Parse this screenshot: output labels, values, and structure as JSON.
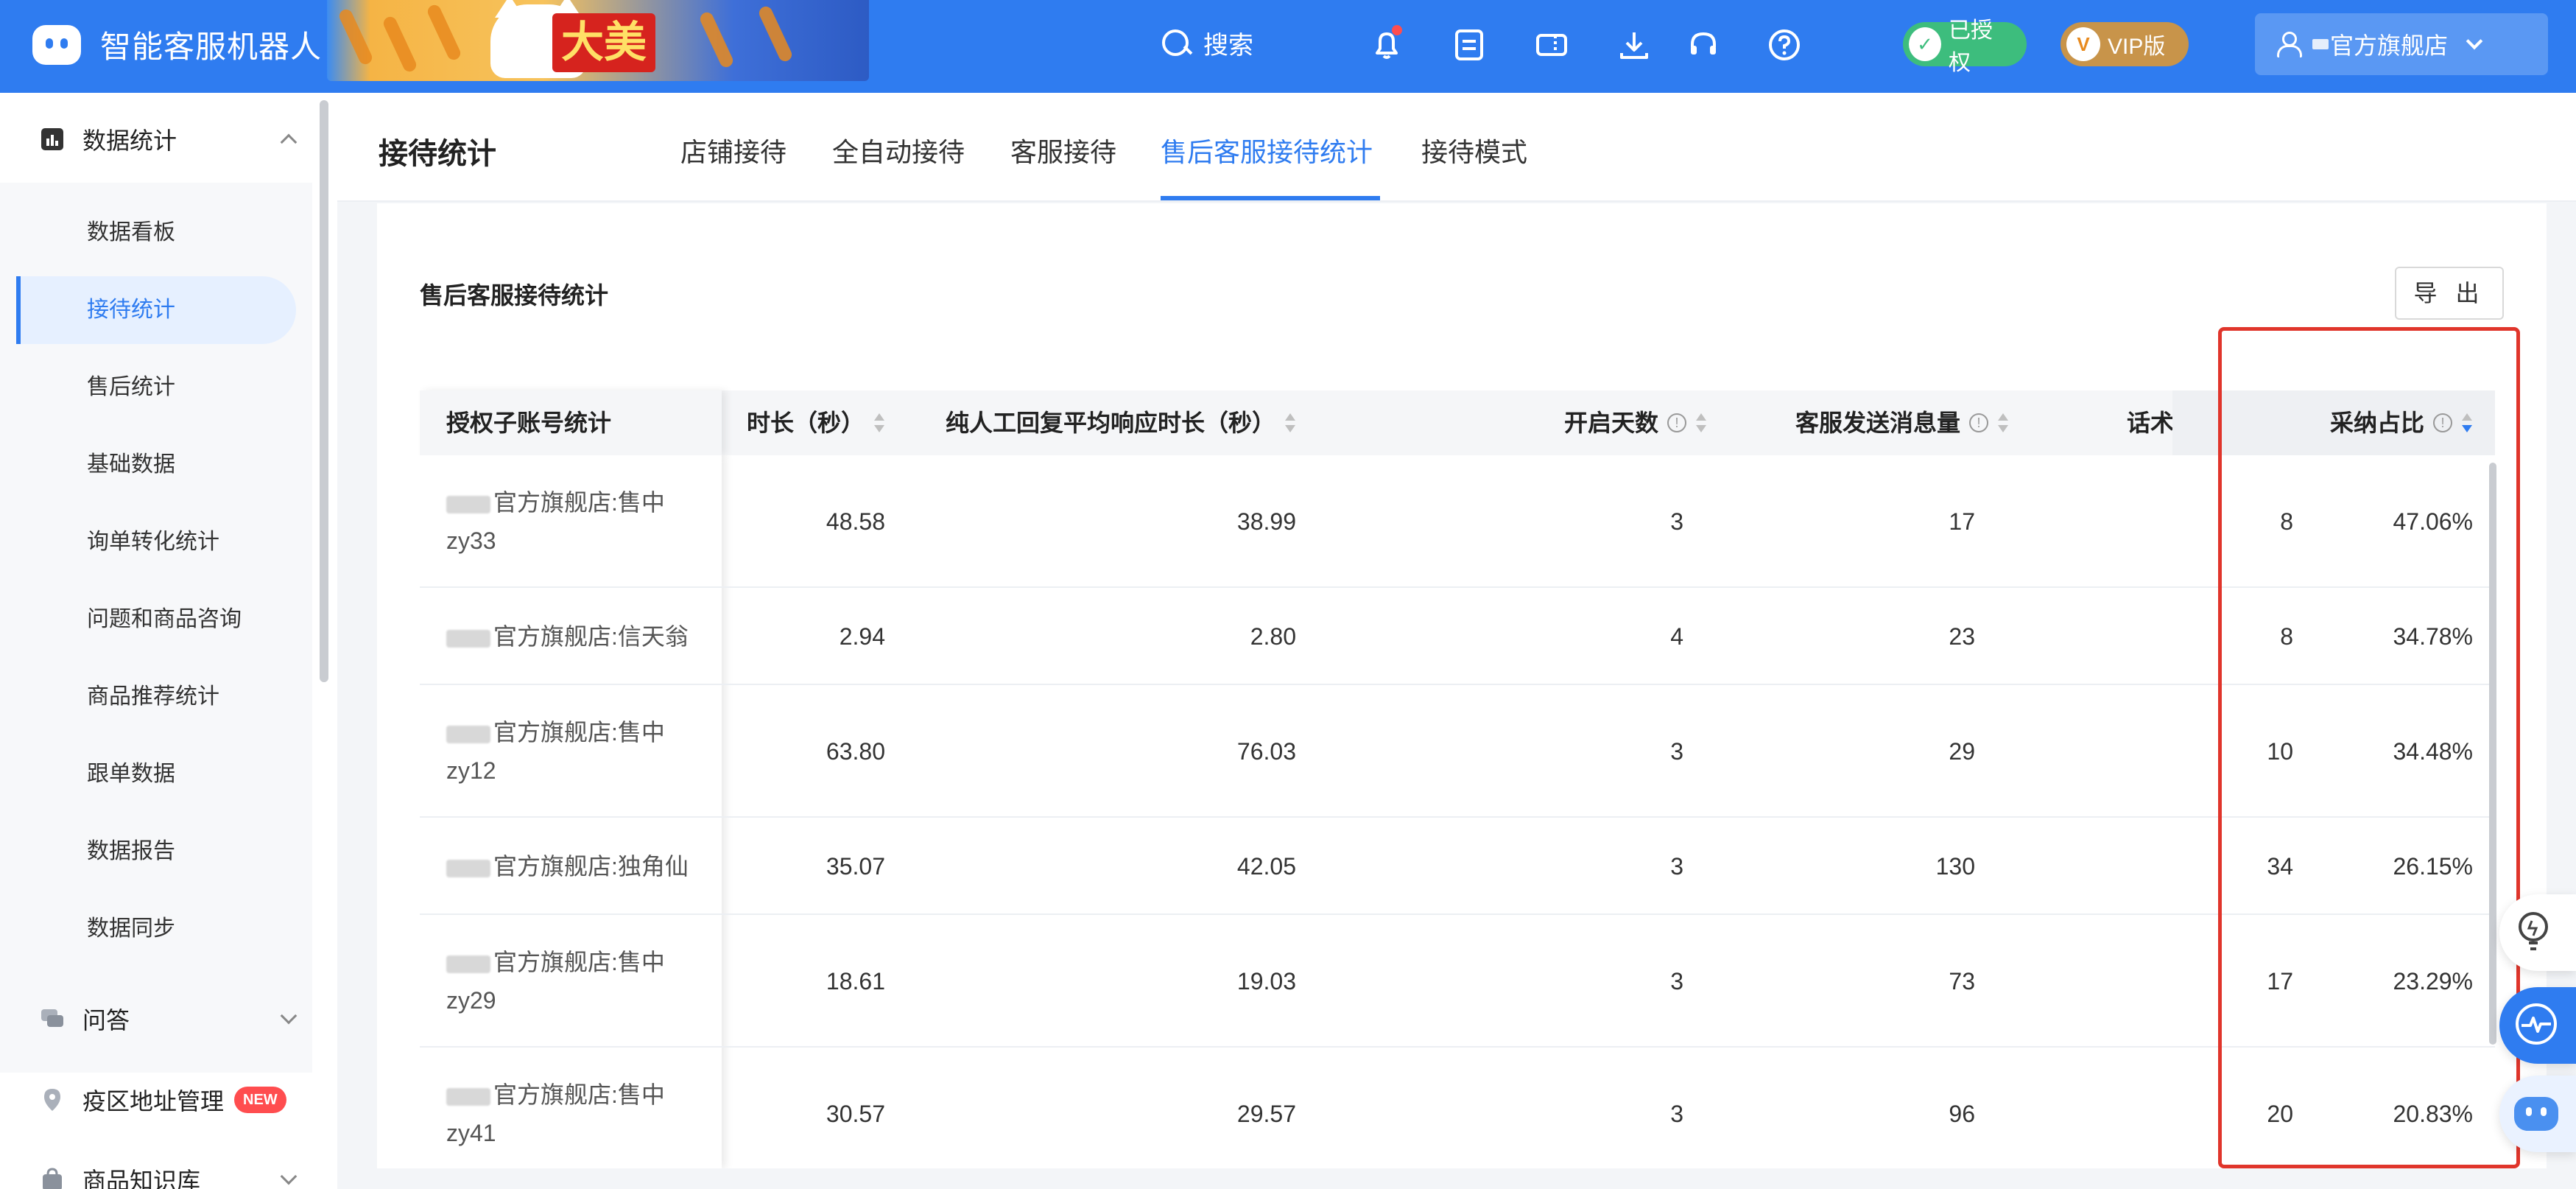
{
  "app": {
    "title": "智能客服机器人",
    "banner_text": "大美"
  },
  "topbar": {
    "search_label": "搜索",
    "auth_badge": "已授权",
    "vip_badge": "VIP版",
    "vip_letter": "V",
    "store_name": "官方旗舰店"
  },
  "sidebar": {
    "section_stats": "数据统计",
    "items": [
      {
        "label": "数据看板"
      },
      {
        "label": "接待统计"
      },
      {
        "label": "售后统计"
      },
      {
        "label": "基础数据"
      },
      {
        "label": "询单转化统计"
      },
      {
        "label": "问题和商品咨询"
      },
      {
        "label": "商品推荐统计"
      },
      {
        "label": "跟单数据"
      },
      {
        "label": "数据报告"
      },
      {
        "label": "数据同步"
      }
    ],
    "section_qa": "问答",
    "section_epidemic": "疫区地址管理",
    "new_badge": "NEW",
    "section_knowledge": "商品知识库"
  },
  "header": {
    "page_title": "接待统计",
    "tabs": [
      {
        "label": "店铺接待"
      },
      {
        "label": "全自动接待"
      },
      {
        "label": "客服接待"
      },
      {
        "label": "售后客服接待统计"
      },
      {
        "label": "接待模式"
      }
    ]
  },
  "card": {
    "title": "售后客服接待统计",
    "export_label": "导 出"
  },
  "table": {
    "columns": [
      {
        "label": "授权子账号统计"
      },
      {
        "label": "时长（秒）"
      },
      {
        "label": "纯人工回复平均响应时长（秒）"
      },
      {
        "label": "开启天数"
      },
      {
        "label": "客服发送消息量"
      },
      {
        "label": "话术采纳次数"
      },
      {
        "label": "采纳占比"
      }
    ],
    "info_glyph": "!",
    "rows": [
      {
        "account_l1": "官方旗舰店:售中",
        "account_l2": "zy33",
        "c1": "48.58",
        "c2": "38.99",
        "days": "3",
        "msgs": "17",
        "adopt": "8",
        "ratio": "47.06%"
      },
      {
        "account_l1": "官方旗舰店:信天翁",
        "account_l2": "",
        "c1": "2.94",
        "c2": "2.80",
        "days": "4",
        "msgs": "23",
        "adopt": "8",
        "ratio": "34.78%"
      },
      {
        "account_l1": "官方旗舰店:售中",
        "account_l2": "zy12",
        "c1": "63.80",
        "c2": "76.03",
        "days": "3",
        "msgs": "29",
        "adopt": "10",
        "ratio": "34.48%"
      },
      {
        "account_l1": "官方旗舰店:独角仙",
        "account_l2": "",
        "c1": "35.07",
        "c2": "42.05",
        "days": "3",
        "msgs": "130",
        "adopt": "34",
        "ratio": "26.15%"
      },
      {
        "account_l1": "官方旗舰店:售中",
        "account_l2": "zy29",
        "c1": "18.61",
        "c2": "19.03",
        "days": "3",
        "msgs": "73",
        "adopt": "17",
        "ratio": "23.29%"
      },
      {
        "account_l1": "官方旗舰店:售中",
        "account_l2": "zy41",
        "c1": "30.57",
        "c2": "29.57",
        "days": "3",
        "msgs": "96",
        "adopt": "20",
        "ratio": "20.83%"
      }
    ]
  },
  "colors": {
    "primary": "#2f7cf0",
    "highlight_box": "#e0352b",
    "auth_green": "#3dbd7d",
    "vip_gold": "#c8944a"
  }
}
